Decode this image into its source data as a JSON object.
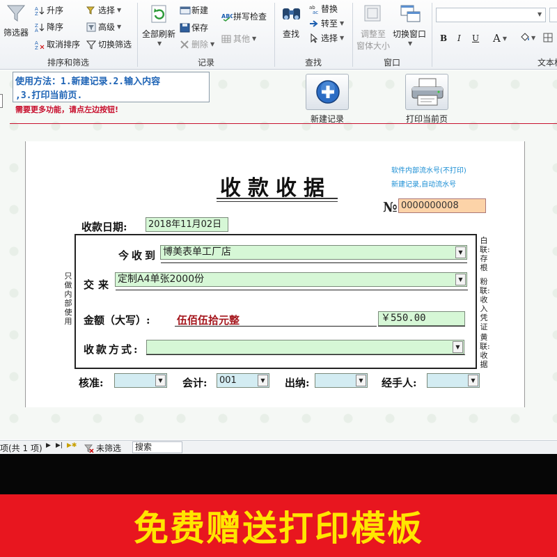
{
  "ribbon": {
    "filter_label": "筛选器",
    "sort_group": {
      "ascending": "升序",
      "descending": "降序",
      "clear_sort": "取消排序",
      "selection": "选择",
      "advanced": "高级",
      "toggle_filter": "切换筛选",
      "group_label": "排序和筛选"
    },
    "records_group": {
      "refresh_all": "全部刷新",
      "new": "新建",
      "save": "保存",
      "delete": "删除",
      "spelling": "拼写检查",
      "more": "其他",
      "group_label": "记录"
    },
    "find_group": {
      "find": "查找",
      "replace": "替换",
      "goto": "转至",
      "select": "选择",
      "group_label": "查找"
    },
    "window_group": {
      "size_to_fit_line1": "调整至",
      "size_to_fit_line2": "窗体大小",
      "switch_windows": "切换窗口",
      "group_label": "窗口"
    },
    "text_group": {
      "bold": "B",
      "italic": "I",
      "underline": "U",
      "font_color": "A",
      "group_label": "文本格"
    }
  },
  "form": {
    "instructions_line1": "使用方法：1.新建记录.2.输入内容",
    "instructions_line2": ",3.打印当前页.",
    "more_features_tip": "需要更多功能，请点左边按钮!",
    "new_record_label": "新建记录",
    "print_label": "打印当前页"
  },
  "receipt": {
    "title": "收款收据",
    "serial_note_line1": "软件内部流水号(不打印)",
    "serial_note_line2": "新建记录,自动流水号",
    "no_symbol": "№",
    "serial_no": "0000000008",
    "date_label": "收款日期:",
    "date_value": "2018年11月02日",
    "received_from_label": "今收到",
    "received_from_value": "博美表单工厂店",
    "for_label": "交来",
    "for_value": "定制A4单张2000份",
    "amount_label": "金额（大写）:",
    "amount_words": "伍佰伍拾元整",
    "amount_value": "￥550.00",
    "payment_method_label": "收款方式:",
    "payment_method_value": "",
    "approver_label": "核准:",
    "accountant_label": "会计:",
    "accountant_value": "001",
    "cashier_label": "出纳:",
    "handler_label": "经手人:",
    "left_side_note": "只做内部使用",
    "right_copy_1": "白联:存根",
    "right_copy_2": "粉联:收入凭证",
    "right_copy_3": "黄联:收据"
  },
  "statusbar": {
    "record_info": "项(共 1 项)",
    "filter_status": "未筛选",
    "search": "搜索"
  },
  "banner": {
    "text": "免费赠送打印模板"
  },
  "colors": {
    "accent_red": "#e8161f",
    "banner_text": "#ffe600",
    "field_green": "#d6f7d6",
    "field_blue": "#d3ecf2",
    "serial_orange": "#fcd3a8",
    "instruction_blue": "#1d63b5"
  }
}
